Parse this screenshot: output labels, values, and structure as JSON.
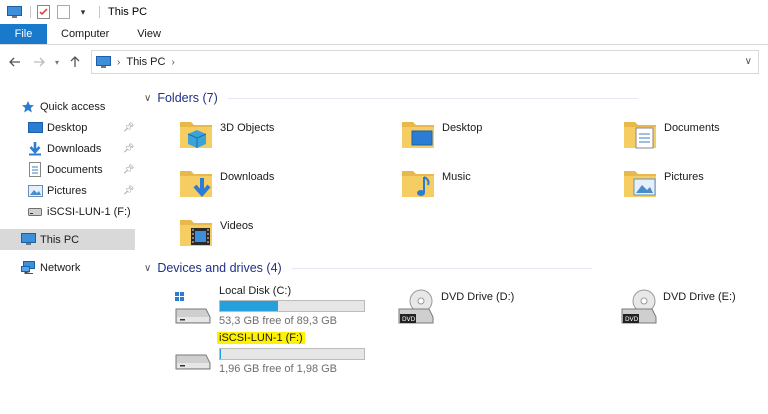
{
  "window": {
    "title": "This PC"
  },
  "ribbon": {
    "tabs": [
      "File",
      "Computer",
      "View"
    ]
  },
  "address": {
    "crumbs": [
      "This PC"
    ]
  },
  "sidebar": {
    "quick_access": "Quick access",
    "items": [
      {
        "label": "Desktop",
        "icon": "desktop-icon",
        "pinned": true
      },
      {
        "label": "Downloads",
        "icon": "downloads-icon",
        "pinned": true
      },
      {
        "label": "Documents",
        "icon": "documents-icon",
        "pinned": true
      },
      {
        "label": "Pictures",
        "icon": "pictures-icon",
        "pinned": true
      },
      {
        "label": "iSCSI-LUN-1 (F:)",
        "icon": "drive-icon",
        "pinned": false
      }
    ],
    "this_pc": "This PC",
    "network": "Network"
  },
  "folders": {
    "header": "Folders (7)",
    "items": [
      {
        "label": "3D Objects",
        "icon": "3d-objects-folder-icon"
      },
      {
        "label": "Desktop",
        "icon": "desktop-folder-icon"
      },
      {
        "label": "Documents",
        "icon": "documents-folder-icon"
      },
      {
        "label": "Downloads",
        "icon": "downloads-folder-icon"
      },
      {
        "label": "Music",
        "icon": "music-folder-icon"
      },
      {
        "label": "Pictures",
        "icon": "pictures-folder-icon"
      },
      {
        "label": "Videos",
        "icon": "videos-folder-icon"
      }
    ]
  },
  "devices": {
    "header": "Devices and drives (4)",
    "items": [
      {
        "name": "Local Disk (C:)",
        "free": "53,3 GB free of 89,3 GB",
        "used_fraction": 0.4,
        "icon": "windows-drive-icon"
      },
      {
        "name": "DVD Drive (D:)",
        "icon": "dvd-drive-icon"
      },
      {
        "name": "DVD Drive (E:)",
        "icon": "dvd-drive-icon"
      },
      {
        "name": "iSCSI-LUN-1 (F:)",
        "free": "1,96 GB free of 1,98 GB",
        "used_fraction": 0.01,
        "icon": "drive-icon",
        "highlighted": true
      }
    ]
  },
  "colors": {
    "accent": "#1979ca",
    "header": "#1e3287",
    "bar": "#26a0da",
    "highlight": "#fff200"
  }
}
